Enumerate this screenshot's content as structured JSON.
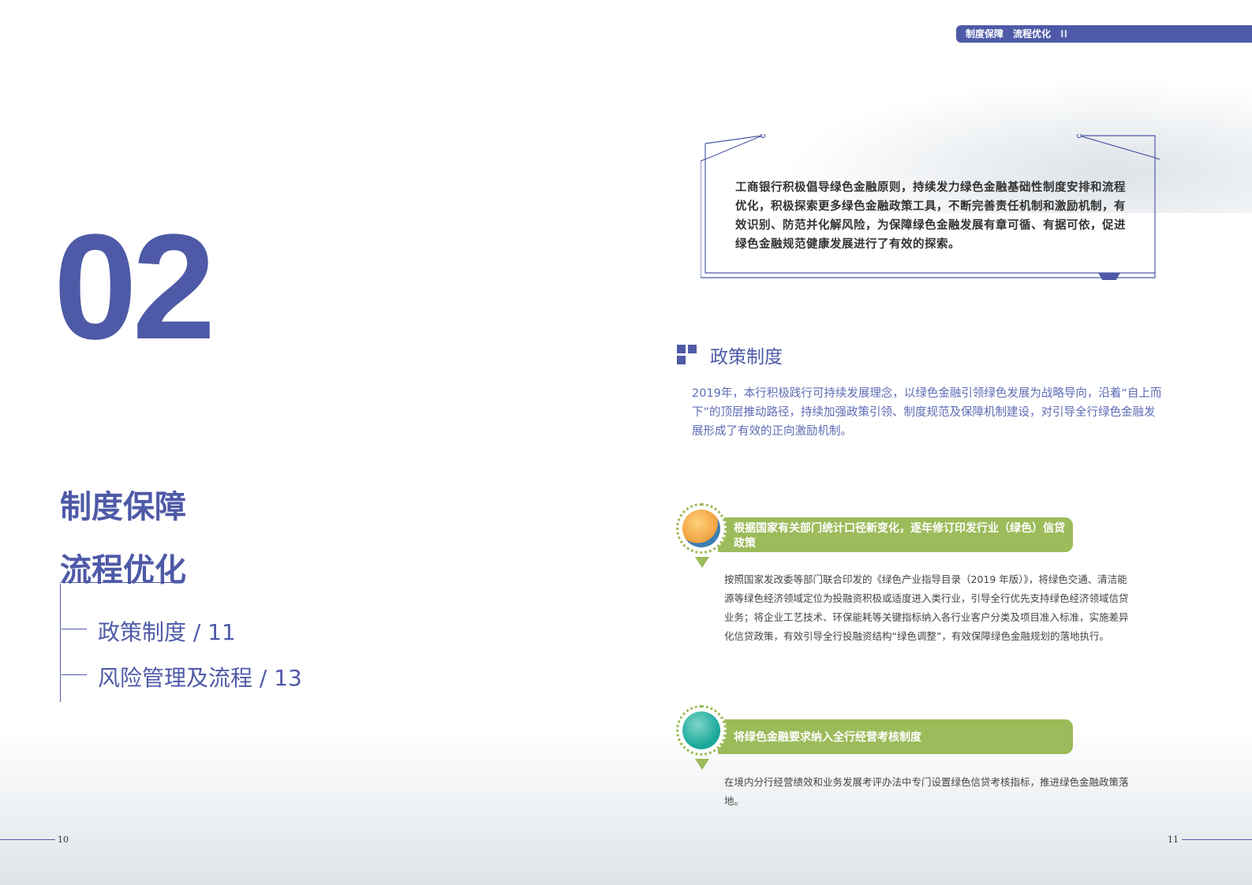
{
  "header": {
    "tags": [
      "制度保障",
      "流程优化"
    ],
    "icon": "dot-grid-icon"
  },
  "chapter": {
    "number": "02",
    "titles": [
      "制度保障",
      "流程优化"
    ],
    "toc": [
      {
        "label": "政策制度 / 11"
      },
      {
        "label": "风险管理及流程 / 13"
      }
    ]
  },
  "quote": "工商银行积极倡导绿色金融原则，持续发力绿色金融基础性制度安排和流程优化，积极探索更多绿色金融政策工具，不断完善责任机制和激励机制，有效识别、防范并化解风险，为保障绿色金融发展有章可循、有据可依，促进绿色金融规范健康发展进行了有效的探索。",
  "section": {
    "title": "政策制度",
    "intro": "2019年，本行积极践行可持续发展理念，以绿色金融引领绿色发展为战略导向，沿着“自上而下”的顶层推动路径，持续加强政策引领、制度规范及保障机制建设，对引导全行绿色金融发展形成了有效的正向激励机制。"
  },
  "items": [
    {
      "title": "根据国家有关部门统计口径新变化，逐年修订印发行业（绿色）信贷政策",
      "icon": "solar-panel-icon",
      "body": "按照国家发改委等部门联合印发的《绿色产业指导目录（2019 年版）》，将绿色交通、清洁能源等绿色经济领域定位为投融资积极或适度进入类行业，引导全行优先支持绿色经济领域信贷业务；将企业工艺技术、环保能耗等关键指标纳入各行业客户分类及项目准入标准，实施差异化信贷政策，有效引导全行投融资结构“绿色调整”，有效保障绿色金融规划的落地执行。"
    },
    {
      "title": "将绿色金融要求纳入全行经营考核制度",
      "icon": "wind-turbine-icon",
      "body": "在境内分行经营绩效和业务发展考评办法中专门设置绿色信贷考核指标，推进绿色金融政策落地。"
    }
  ],
  "pages": {
    "left": "10",
    "right": "11"
  },
  "colors": {
    "brand": "#4e5aa7",
    "green": "#9cbb5a"
  }
}
